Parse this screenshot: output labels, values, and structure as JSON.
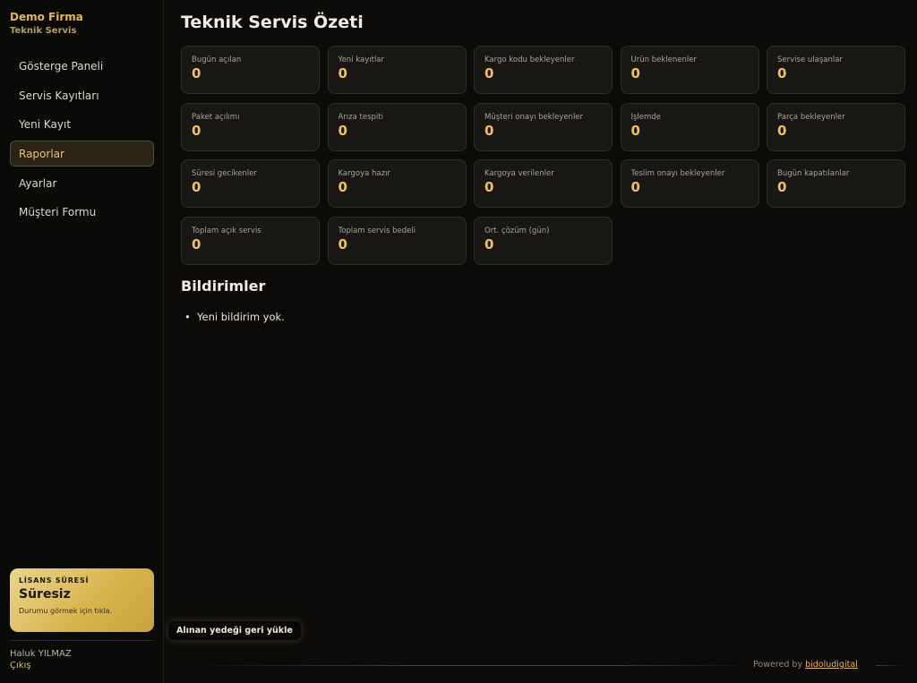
{
  "brand": {
    "name": "Demo Firma",
    "subtitle": "Teknik Servis"
  },
  "nav": {
    "items": [
      {
        "label": "Gösterge Paneli",
        "active": false
      },
      {
        "label": "Servis Kayıtları",
        "active": false
      },
      {
        "label": "Yeni Kayıt",
        "active": false
      },
      {
        "label": "Raporlar",
        "active": true
      },
      {
        "label": "Ayarlar",
        "active": false
      },
      {
        "label": "Müşteri Formu",
        "active": false
      }
    ]
  },
  "license": {
    "label": "LİSANS SÜRESİ",
    "value": "Süresiz",
    "hint": "Durumu görmek için tıkla."
  },
  "user": {
    "name": "Haluk YILMAZ",
    "logout_label": "Çıkış"
  },
  "main": {
    "title": "Teknik Servis Özeti",
    "cards": [
      {
        "label": "Bugün açılan",
        "value": "0"
      },
      {
        "label": "Yeni kayıtlar",
        "value": "0"
      },
      {
        "label": "Kargo kodu bekleyenler",
        "value": "0"
      },
      {
        "label": "Ürün beklenenler",
        "value": "0"
      },
      {
        "label": "Servise ulaşanlar",
        "value": "0"
      },
      {
        "label": "Paket açılımı",
        "value": "0"
      },
      {
        "label": "Arıza tespiti",
        "value": "0"
      },
      {
        "label": "Müşteri onayı bekleyenler",
        "value": "0"
      },
      {
        "label": "İşlemde",
        "value": "0"
      },
      {
        "label": "Parça bekleyenler",
        "value": "0"
      },
      {
        "label": "Süresi gecikenler",
        "value": "0"
      },
      {
        "label": "Kargoya hazır",
        "value": "0"
      },
      {
        "label": "Kargoya verilenler",
        "value": "0"
      },
      {
        "label": "Teslim onayı bekleyenler",
        "value": "0"
      },
      {
        "label": "Bugün kapatılanlar",
        "value": "0"
      },
      {
        "label": "Toplam açık servis",
        "value": "0"
      },
      {
        "label": "Toplam servis bedeli",
        "value": "0"
      },
      {
        "label": "Ort. çözüm (gün)",
        "value": "0"
      }
    ],
    "notifications_title": "Bildirimler",
    "notifications": [
      "Yeni bildirim yok."
    ]
  },
  "restore_button_label": "Alınan yedeği geri yükle",
  "footer": {
    "powered_by": "Powered by",
    "link_label": "bidoludigital"
  },
  "colors": {
    "accent": "#e2b950",
    "background": "#0c0b09",
    "card": "#181713"
  }
}
